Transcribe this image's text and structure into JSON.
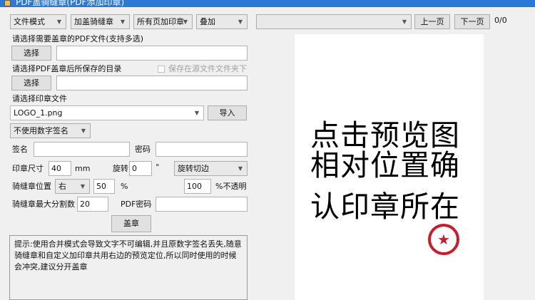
{
  "window": {
    "title": "PDF盖骑缝章(PDF添加印章)"
  },
  "toolbar": {
    "mode": "文件模式",
    "stamp_type": "加盖骑缝章",
    "page_scope": "所有页加印章",
    "blend": "叠加",
    "preview_select": "",
    "prev_label": "上一页",
    "next_label": "下一页",
    "page_counter": "0/0"
  },
  "pdf_files": {
    "label": "请选择需要盖章的PDF文件(支持多选)",
    "button": "选择",
    "value": ""
  },
  "output_dir": {
    "label": "请选择PDF盖章后所保存的目录",
    "checkbox_label": "保存在源文件文件夹下",
    "button": "选择",
    "value": ""
  },
  "stamp_file": {
    "label": "请选择印章文件",
    "value": "LOGO_1.png",
    "import_label": "导入"
  },
  "digital_signature": {
    "value": "不使用数字签名"
  },
  "sign": {
    "name_label": "签名",
    "name_value": "",
    "password_label": "密码",
    "password_value": ""
  },
  "size": {
    "label": "印章尺寸",
    "value": "40",
    "unit": "mm",
    "rotate_label": "旋转",
    "rotate_value": "0",
    "degree": "°",
    "rotate_mode": "旋转切边"
  },
  "seam": {
    "label": "骑缝章位置",
    "side": "右",
    "percent_value": "50",
    "percent_unit": "%",
    "opacity_value": "100",
    "opacity_label": "%不透明"
  },
  "split": {
    "label": "骑缝章最大分割数",
    "value": "20",
    "pdf_password_label": "PDF密码",
    "pdf_password_value": ""
  },
  "stamp_button": "盖章",
  "tip": "提示:使用合并模式会导致文字不可编辑,并且原数字签名丢失,随意骑缝章和自定义加印章共用右边的预览定位,所以同时使用的时候会冲突,建议分开盖章",
  "preview": {
    "lines": [
      "点击预览图",
      "相对位置确",
      "认印章所在"
    ],
    "stamp_glyph": "★",
    "stamp_color": "#c81c2a"
  }
}
